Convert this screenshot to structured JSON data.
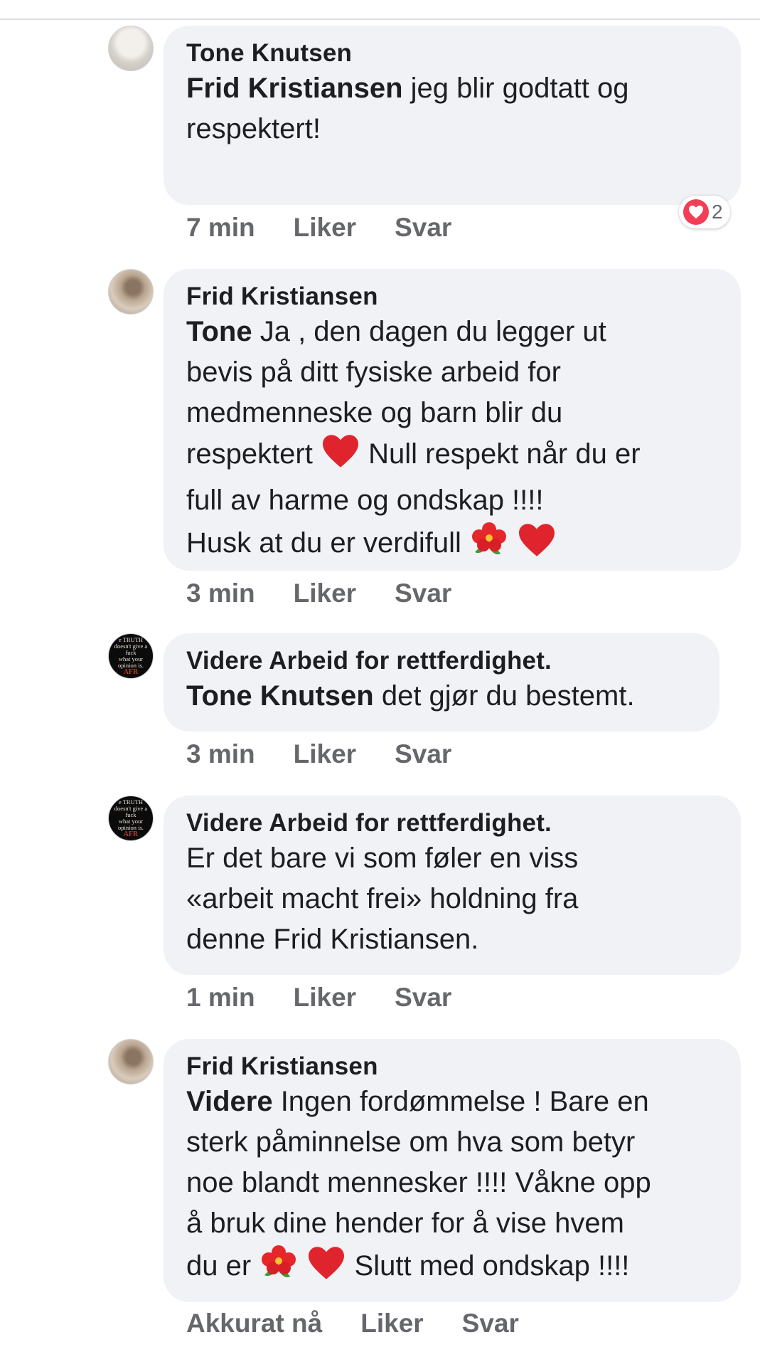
{
  "comments": [
    {
      "author": "Tone Knutsen",
      "mention": "Frid Kristiansen",
      "lines": [
        "jeg blir godtatt og",
        "respektert!"
      ],
      "time": "7 min",
      "like_label": "Liker",
      "reply_label": "Svar",
      "reaction": {
        "icon": "love-reaction-icon",
        "count": "2",
        "color": "#f33e58"
      }
    },
    {
      "author": "Frid Kristiansen",
      "mention": "Tone",
      "lines": [
        "Ja , den dagen du legger ut",
        "bevis på ditt fysiske arbeid for",
        "medmenneske og barn blir du",
        "respektert",
        "Null respekt når du er",
        "full av harme og ondskap !!!!",
        "Husk at du er verdifull"
      ],
      "emojis": [
        "red-heart-emoji",
        "hibiscus-emoji"
      ],
      "time": "3 min",
      "like_label": "Liker",
      "reply_label": "Svar"
    },
    {
      "author": "Videre Arbeid for rettferdighet.",
      "mention": "Tone Knutsen",
      "lines": [
        "det gjør du bestemt."
      ],
      "time": "3 min",
      "like_label": "Liker",
      "reply_label": "Svar"
    },
    {
      "author": "Videre Arbeid for rettferdighet.",
      "mention": "",
      "lines": [
        "Er det bare vi som føler en viss",
        "«arbeit macht frei» holdning fra",
        "denne Frid Kristiansen."
      ],
      "time": "1 min",
      "like_label": "Liker",
      "reply_label": "Svar"
    },
    {
      "author": "Frid Kristiansen",
      "mention": "Videre",
      "lines": [
        "Ingen fordømmelse ! Bare en",
        "sterk påminnelse om hva som betyr",
        "noe blandt mennesker !!!! Våkne opp",
        "å bruk dine hender for å vise hvem",
        "du er",
        "Slutt med ondskap !!!!"
      ],
      "time": "Akkurat nå",
      "like_label": "Liker",
      "reply_label": "Svar"
    }
  ],
  "avatars": {
    "videre_text": [
      "e TRUTH",
      "doesn't give a",
      "fuck",
      "what your",
      "opinion is.",
      "AFR"
    ]
  },
  "colors": {
    "bubble": "#f0f2f5",
    "meta_text": "#65676b",
    "heart": "#f33e58"
  }
}
